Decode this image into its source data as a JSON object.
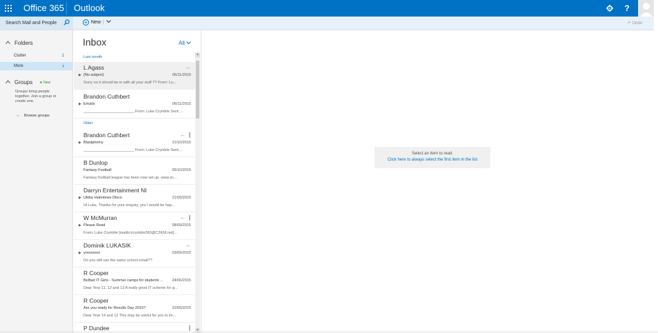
{
  "topbar": {
    "brand": "Office 365",
    "app": "Outlook",
    "icons": [
      "app-launcher-icon",
      "gear-icon",
      "help-icon",
      "user-avatar"
    ],
    "help_label": "?",
    "accent": "#0072c6"
  },
  "commandbar": {
    "search_placeholder": "Search Mail and People",
    "new_label": "New",
    "undo_label": "Undo"
  },
  "nav": {
    "folders_heading": "Folders",
    "items": [
      {
        "label": "Clutter",
        "count": "1"
      },
      {
        "label": "More"
      }
    ],
    "groups_heading": "Groups",
    "groups_new": "New",
    "groups_text": "Groups bring people together. Join a group or create one.",
    "browse_label": "Browse groups"
  },
  "list": {
    "title": "Inbox",
    "filter": "All",
    "group_last_month": "Last month",
    "group_older": "Older",
    "messages": [
      {
        "sender": "L Agass",
        "subject": "(No subject)",
        "date": "06/11/2015",
        "preview": "Sorry no it should be in with all your stuff ?? From: Lu..."
      },
      {
        "sender": "Brandon Cuthbert",
        "subject": "Emails",
        "date": "06/11/2015",
        "preview": "________________________ From: Luke Crymble Sent:..."
      },
      {
        "sender": "Brandon Cuthbert",
        "subject": "Blastphemy",
        "date": "21/10/2015",
        "preview": "________________________ From: Luke Crymble Sent:..."
      },
      {
        "sender": "B Dunlop",
        "subject": "Fantasy Football",
        "date": "05/10/2015",
        "preview": "Fantasy football league has been now set up. www.sc..."
      },
      {
        "sender": "Darryn Entertainment NI",
        "subject": "Ulidia Valentines Disco",
        "date": "21/09/2015",
        "preview": "Hi Luke, Thanks for your enquiry, yes I would be hap..."
      },
      {
        "sender": "W McMurran",
        "subject": "Please Read",
        "date": "08/09/2015",
        "preview": "From: Luke Crymble [mailto:lcrymble360@C2KNI.net]..."
      },
      {
        "sender": "Dominik LUKASIK",
        "subject": "yooooooo",
        "date": "03/09/2015",
        "preview": "Do you still use the same school email??"
      },
      {
        "sender": "R Cooper",
        "subject": "Belfast IT Girls - Summer camps for students ...",
        "date": "24/06/2015",
        "preview": "Dear Year 11, 12 and 13 A really good IT scheme for g..."
      },
      {
        "sender": "R Cooper",
        "subject": "Are you ready for Results Day 2015?",
        "date": "22/05/2015",
        "preview": "Dear Year 14 and 12 This may be useful for you to lin..."
      },
      {
        "sender": "P Dundee",
        "subject": "",
        "date": "",
        "preview": ""
      }
    ]
  },
  "reading": {
    "empty_line1": "Select an item to read.",
    "empty_line2": "Click here to always select the first item in the list"
  }
}
